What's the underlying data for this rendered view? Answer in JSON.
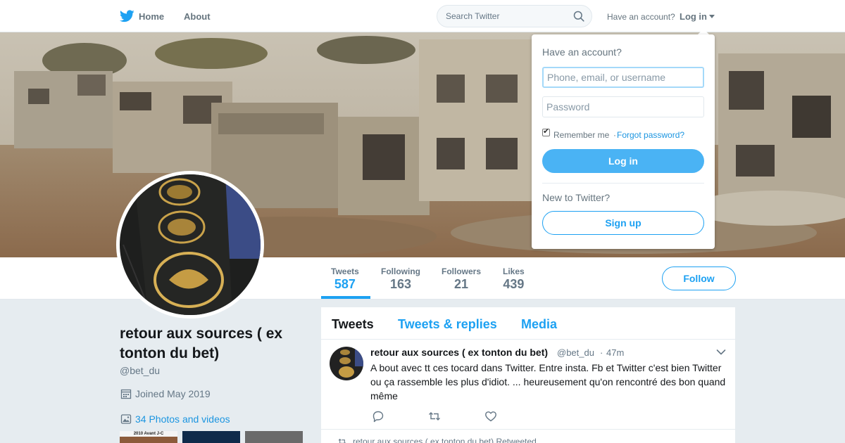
{
  "colors": {
    "brand": "#1da1f2",
    "link": "#1b95e0",
    "text_primary": "#14171a",
    "text_secondary": "#657786",
    "page_bg": "#e6ecf0"
  },
  "topbar": {
    "logo_icon": "twitter-bird-icon",
    "nav": [
      {
        "label": "Home",
        "icon": "home-bird-icon"
      },
      {
        "label": "About"
      }
    ],
    "search": {
      "placeholder": "Search Twitter",
      "value": "",
      "icon": "search-icon"
    },
    "have_account": "Have an account?",
    "login_label": "Log in"
  },
  "profile_nav": {
    "stats": [
      {
        "label": "Tweets",
        "value": "587",
        "active": true
      },
      {
        "label": "Following",
        "value": "163"
      },
      {
        "label": "Followers",
        "value": "21"
      },
      {
        "label": "Likes",
        "value": "439"
      }
    ],
    "follow_label": "Follow"
  },
  "profile": {
    "name": "retour aux sources ( ex tonton du bet)",
    "handle": "@bet_du",
    "joined": "Joined May 2019",
    "photos_label": "34 Photos and videos",
    "thumbnails": [
      {
        "caption": "2010 Avant J-C"
      },
      {
        "caption": ""
      },
      {
        "caption": ""
      }
    ]
  },
  "timeline": {
    "tabs": [
      {
        "label": "Tweets",
        "active": true
      },
      {
        "label": "Tweets & replies"
      },
      {
        "label": "Media"
      }
    ],
    "tweets": [
      {
        "fullname": "retour aux sources ( ex tonton du bet)",
        "handle": "@bet_du",
        "separator": "·",
        "time": "47m",
        "text": "A bout avec tt ces tocard dans Twitter. Entre insta. Fb et Twitter c'est bien Twitter ou ça rassemble les plus d'idiot. ... heureusement qu'on rencontré des bon quand même",
        "actions": [
          "reply-icon",
          "retweet-icon",
          "like-icon"
        ]
      }
    ],
    "retweeted_note": "retour aux sources ( ex tonton du bet) Retweeted"
  },
  "login_dropdown": {
    "title": "Have an account?",
    "username_placeholder": "Phone, email, or username",
    "username_value": "",
    "password_placeholder": "Password",
    "password_value": "",
    "remember_label": "Remember me",
    "remember_checked": true,
    "separator": "·",
    "forgot_label": "Forgot password?",
    "login_button": "Log in",
    "new_to_twitter": "New to Twitter?",
    "signup_button": "Sign up"
  }
}
